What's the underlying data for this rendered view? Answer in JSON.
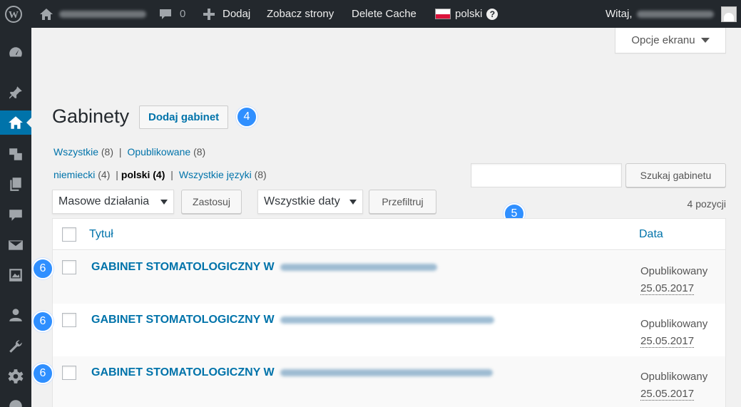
{
  "adminbar": {
    "comments_count": "0",
    "add_new_label": "Dodaj",
    "view_site_label": "Zobacz strony",
    "delete_cache_label": "Delete Cache",
    "language_label": "polski",
    "greeting_label": "Witaj,"
  },
  "screen_options": {
    "label": "Opcje ekranu"
  },
  "page": {
    "title": "Gabinety",
    "add_new_label": "Dodaj gabinet"
  },
  "views": {
    "all_label": "Wszystkie",
    "all_count": "(8)",
    "published_label": "Opublikowane",
    "published_count": "(8)"
  },
  "languages": {
    "german_label": "niemiecki",
    "german_count": "(4)",
    "polish_label": "polski",
    "polish_count": "(4)",
    "all_label": "Wszystkie języki",
    "all_count": "(8)"
  },
  "search": {
    "button_label": "Szukaj gabinetu",
    "value": ""
  },
  "bulk_actions": {
    "selected": "Masowe działania",
    "apply_label": "Zastosuj"
  },
  "date_filter": {
    "selected": "Wszystkie daty",
    "filter_label": "Przefiltruj"
  },
  "items_count": "4 pozycji",
  "table": {
    "col_title": "Tytuł",
    "col_date": "Data",
    "rows": [
      {
        "title": "GABINET STOMATOLOGICZNY W",
        "status": "Opublikowany",
        "date": "25.05.2017"
      },
      {
        "title": "GABINET STOMATOLOGICZNY W",
        "status": "Opublikowany",
        "date": "25.05.2017"
      },
      {
        "title": "GABINET STOMATOLOGICZNY W",
        "status": "Opublikowany",
        "date": "25.05.2017"
      }
    ]
  },
  "annotations": {
    "badge_add": "4",
    "badge_search": "5",
    "badge_row": "6"
  },
  "colors": {
    "accent": "#0073aa",
    "admin_bar": "#23282d",
    "badge": "#2f8fff"
  }
}
